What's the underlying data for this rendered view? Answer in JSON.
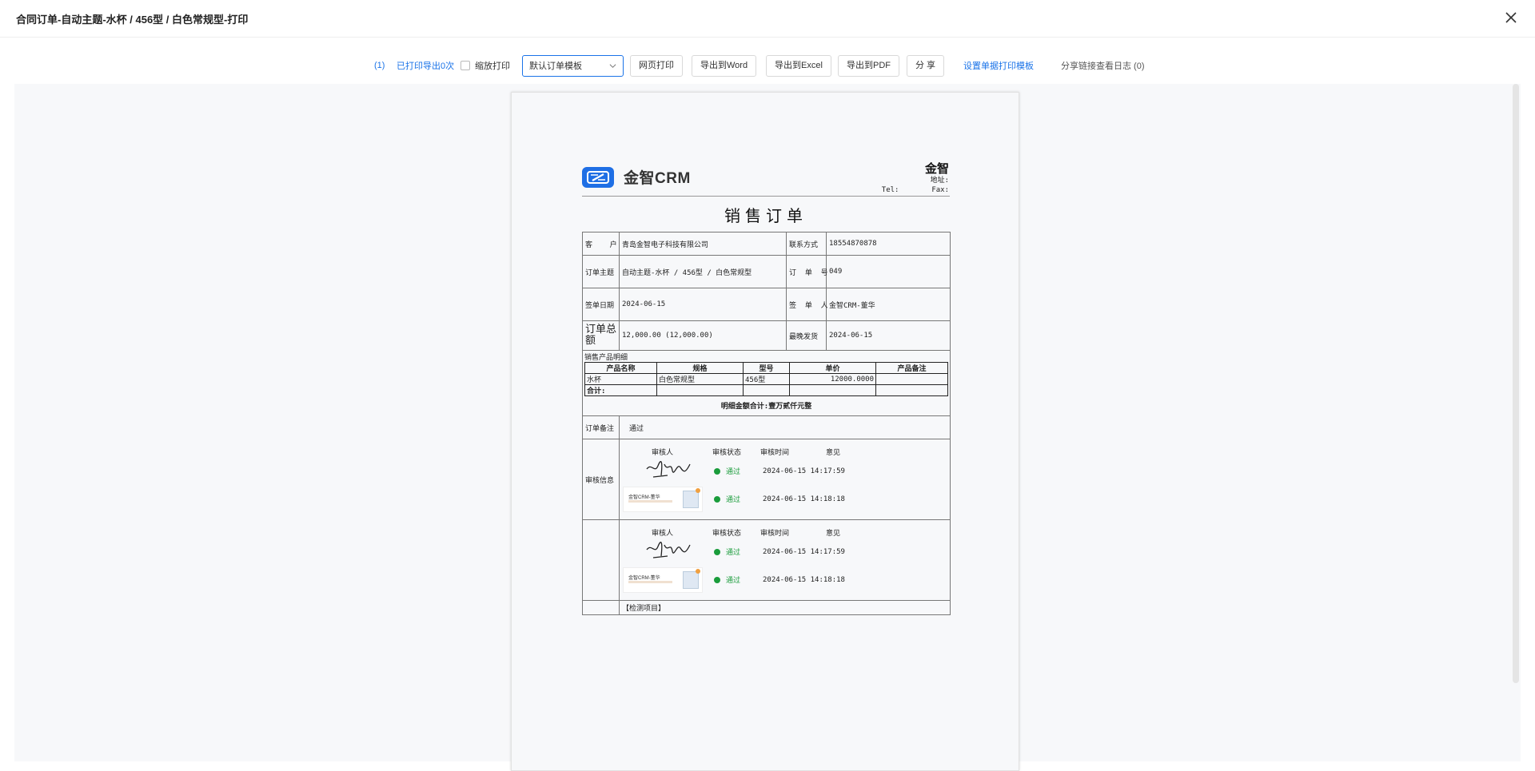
{
  "window": {
    "title": "合同订单-自动主题-水杯 / 456型 / 白色常规型-打印"
  },
  "toolbar": {
    "count_prefix": "(1)",
    "printed_label": "已打印导出0次",
    "scale_print_label": "缩放打印",
    "template_select": "默认订单模板",
    "web_print": "网页打印",
    "export_word": "导出到Word",
    "export_excel": "导出到Excel",
    "export_pdf": "导出到PDF",
    "share": "分 享",
    "set_template": "设置单据打印模板",
    "share_log": "分享链接查看日志 (0)"
  },
  "document": {
    "logo_text": "金智CRM",
    "company_name": "金智",
    "address_label": "地址:",
    "tel_label": "Tel:",
    "fax_label": "Fax:",
    "title": "销售订单",
    "fields": {
      "customer_label": "客    户",
      "customer_value": "青岛金智电子科技有限公司",
      "contact_label": "联系方式",
      "contact_value": "18554870878",
      "subject_label": "订单主题",
      "subject_value": "自动主题-水杯 / 456型 / 白色常规型",
      "order_no_label": "订  单  号",
      "order_no_value": "049",
      "sign_date_label": "签单日期",
      "sign_date_value": "2024-06-15",
      "signer_label": "签  单  人",
      "signer_value": "金智CRM-董华",
      "total_label": "订单总额",
      "total_value": "12,000.00 (12,000.00)",
      "ship_label": "最晚发货",
      "ship_value": "2024-06-15"
    },
    "items_section_label": "销售产品明细",
    "items_headers": [
      "产品名称",
      "规格",
      "型号",
      "单价",
      "产品备注"
    ],
    "items_rows": [
      [
        "水杯",
        "白色常规型",
        "456型",
        "12000.0000",
        ""
      ]
    ],
    "items_total_label": "合计:",
    "amount_words": "明细金额合计:壹万贰仟元整",
    "remark_label": "订单备注",
    "remark_value": "通过",
    "audit_label": "审核信息",
    "audit_headers": [
      "审核人",
      "审核状态",
      "审核时间",
      "意见"
    ],
    "audit_blocks": [
      [
        {
          "status": "通过",
          "time": "2024-06-15 14:17:59"
        },
        {
          "status": "通过",
          "time": "2024-06-15 14:18:18"
        }
      ],
      [
        {
          "status": "通过",
          "time": "2024-06-15 14:17:59"
        },
        {
          "status": "通过",
          "time": "2024-06-15 14:18:18"
        }
      ]
    ],
    "stamp_text": "金智CRM-董华",
    "inspection_label": "【检测项目】"
  },
  "colors": {
    "accent": "#1a73e8",
    "pass": "#1a9c3b",
    "logo": "#1f6fe5"
  }
}
